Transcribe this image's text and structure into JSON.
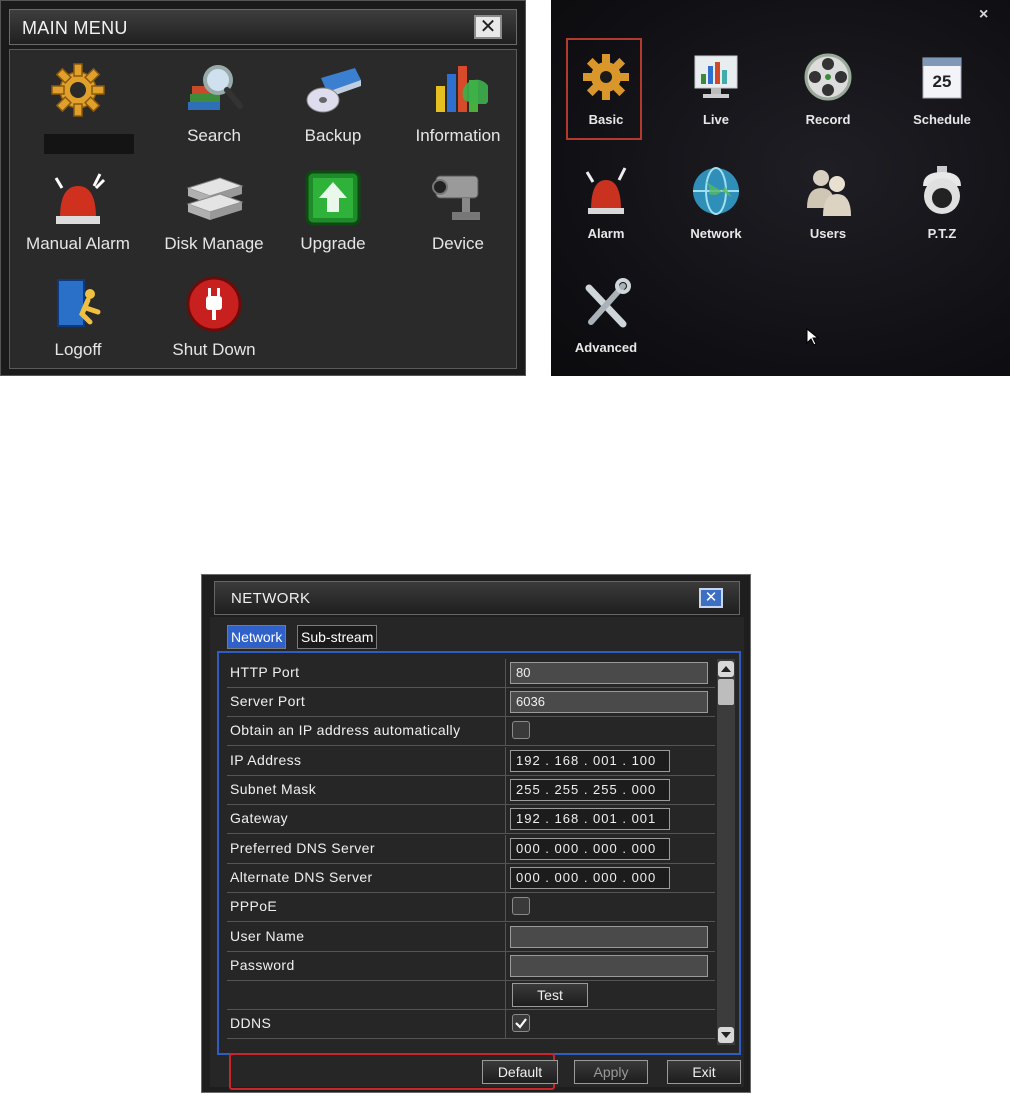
{
  "main_menu": {
    "title": "MAIN MENU",
    "close_glyph": "✕",
    "items": [
      {
        "label": "",
        "icon": "gear-icon"
      },
      {
        "label": "Search",
        "icon": "search-icon"
      },
      {
        "label": "Backup",
        "icon": "backup-icon"
      },
      {
        "label": "Information",
        "icon": "information-icon"
      },
      {
        "label": "Manual Alarm",
        "icon": "alarm-icon"
      },
      {
        "label": "Disk Manage",
        "icon": "disk-icon"
      },
      {
        "label": "Upgrade",
        "icon": "upgrade-icon"
      },
      {
        "label": "Device",
        "icon": "camera-icon"
      },
      {
        "label": "Logoff",
        "icon": "logoff-icon"
      },
      {
        "label": "Shut Down",
        "icon": "power-icon"
      }
    ]
  },
  "photo_menu": {
    "close_glyph": "×",
    "items": [
      {
        "label": "Basic",
        "icon": "gear-icon"
      },
      {
        "label": "Live",
        "icon": "monitor-icon"
      },
      {
        "label": "Record",
        "icon": "film-reel-icon"
      },
      {
        "label": "Schedule",
        "icon": "calendar-icon",
        "calendar_day": "25"
      },
      {
        "label": "Alarm",
        "icon": "alarm-icon"
      },
      {
        "label": "Network",
        "icon": "globe-icon"
      },
      {
        "label": "Users",
        "icon": "users-icon"
      },
      {
        "label": "P.T.Z",
        "icon": "ptz-camera-icon"
      },
      {
        "label": "Advanced",
        "icon": "tools-icon"
      }
    ]
  },
  "network": {
    "title": "NETWORK",
    "close_glyph": "✕",
    "tabs": [
      "Network",
      "Sub-stream"
    ],
    "rows": [
      {
        "label": "HTTP Port",
        "type": "text",
        "value": "80"
      },
      {
        "label": "Server Port",
        "type": "text",
        "value": "6036"
      },
      {
        "label": "Obtain an IP address automatically",
        "type": "checkbox",
        "checked": false
      },
      {
        "label": "IP Address",
        "type": "ip",
        "value": "192 . 168 . 001 . 100"
      },
      {
        "label": "Subnet Mask",
        "type": "ip",
        "value": "255 . 255 . 255 . 000"
      },
      {
        "label": "Gateway",
        "type": "ip",
        "value": "192 . 168 . 001 . 001"
      },
      {
        "label": "Preferred DNS Server",
        "type": "ip",
        "value": "000 . 000 . 000 . 000"
      },
      {
        "label": "Alternate DNS Server",
        "type": "ip",
        "value": "000 . 000 . 000 . 000"
      },
      {
        "label": "PPPoE",
        "type": "checkbox",
        "checked": false
      },
      {
        "label": "User Name",
        "type": "text",
        "value": ""
      },
      {
        "label": "Password",
        "type": "text",
        "value": ""
      },
      {
        "label": "",
        "type": "button",
        "value": "Test"
      },
      {
        "label": "DDNS",
        "type": "checkbox",
        "checked": true
      }
    ],
    "buttons": {
      "default": "Default",
      "apply": "Apply",
      "exit": "Exit"
    },
    "highlight_color": "#c8262b",
    "accent_color": "#2f61c8"
  }
}
